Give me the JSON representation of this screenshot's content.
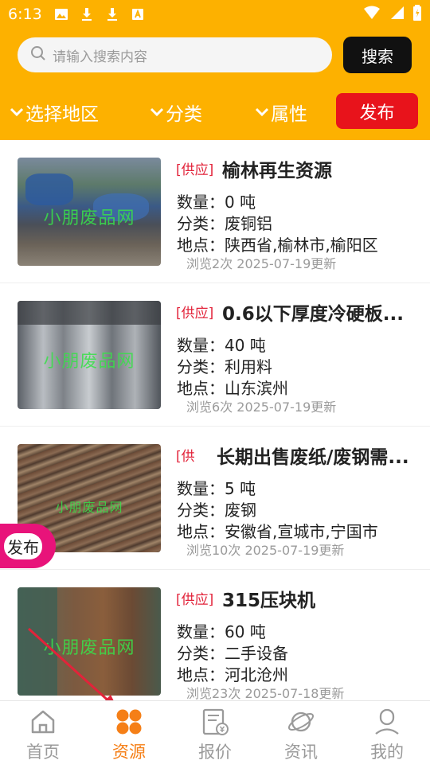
{
  "status_bar": {
    "time": "6:13"
  },
  "search": {
    "placeholder": "请输入搜索内容",
    "button_label": "搜索"
  },
  "filters": {
    "region": "选择地区",
    "category": "分类",
    "attribute": "属性",
    "publish_label": "发布"
  },
  "listings": [
    {
      "tag": "[供应]",
      "title": "榆林再生资源",
      "quantity": "数量：0 吨",
      "category": "分类：废铜铝",
      "location": "地点：陕西省,榆林市,榆阳区",
      "meta": "浏览2次 2025-07-19更新",
      "watermark": "小朋废品网"
    },
    {
      "tag": "[供应]",
      "title": "0.6以下厚度冷硬板...",
      "quantity": "数量：40 吨",
      "category": "分类：利用料",
      "location": "地点：山东滨州",
      "meta": "浏览6次 2025-07-19更新",
      "watermark": "小朋废品网"
    },
    {
      "tag": "[供",
      "title": "长期出售废纸/废钢需...",
      "quantity": "数量：5 吨",
      "category": "分类：废钢",
      "location": "地点：安徽省,宣城市,宁国市",
      "meta": "浏览10次 2025-07-19更新",
      "watermark": "小朋废品网"
    },
    {
      "tag": "[供应]",
      "title": "315压块机",
      "quantity": "数量：60 吨",
      "category": "分类：二手设备",
      "location": "地点：河北沧州",
      "meta": "浏览23次 2025-07-18更新",
      "watermark": "小朋废品网"
    }
  ],
  "floating": {
    "publish_label": "发布"
  },
  "bottom_nav": [
    {
      "label": "首页",
      "icon": "home-icon",
      "active": false
    },
    {
      "label": "资源",
      "icon": "resource-grid-icon",
      "active": true
    },
    {
      "label": "报价",
      "icon": "price-sheet-icon",
      "active": false
    },
    {
      "label": "资讯",
      "icon": "planet-icon",
      "active": false
    },
    {
      "label": "我的",
      "icon": "user-icon",
      "active": false
    }
  ],
  "colors": {
    "header": "#fdb100",
    "publish": "#e8131b",
    "tag": "#e2233a",
    "active_nav": "#f57f17",
    "float_publish": "#e8137a"
  }
}
